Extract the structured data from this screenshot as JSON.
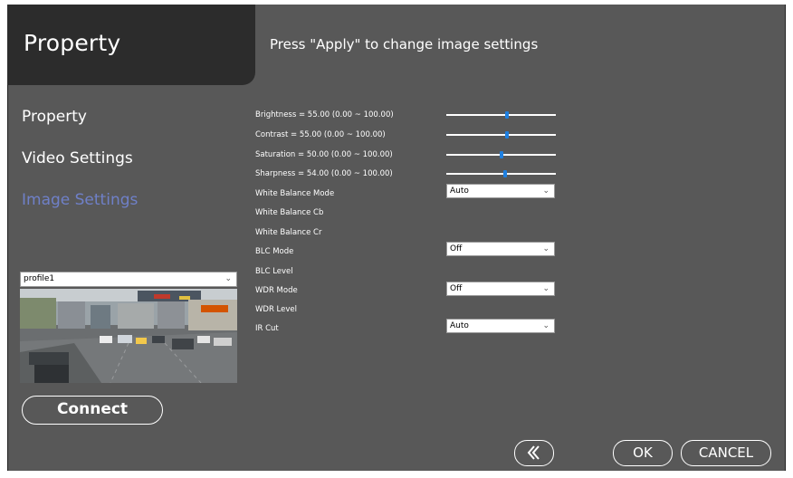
{
  "header": {
    "title": "Property",
    "message": "Press \"Apply\" to change image settings"
  },
  "sidebar": {
    "items": [
      {
        "label": "Property",
        "active": false
      },
      {
        "label": "Video Settings",
        "active": false
      },
      {
        "label": "Image Settings",
        "active": true
      }
    ],
    "profile_select": {
      "value": "profile1",
      "icon": "chevron-down-icon"
    },
    "connect_label": "Connect"
  },
  "settings": {
    "sliders": [
      {
        "label": "Brightness = 55.00 (0.00 ~ 100.00)",
        "value": 55.0,
        "min": 0.0,
        "max": 100.0
      },
      {
        "label": "Contrast = 55.00 (0.00 ~ 100.00)",
        "value": 55.0,
        "min": 0.0,
        "max": 100.0
      },
      {
        "label": "Saturation = 50.00 (0.00 ~ 100.00)",
        "value": 50.0,
        "min": 0.0,
        "max": 100.0
      },
      {
        "label": "Sharpness = 54.00 (0.00 ~ 100.00)",
        "value": 54.0,
        "min": 0.0,
        "max": 100.0
      }
    ],
    "white_balance_mode": {
      "label": "White Balance Mode",
      "value": "Auto"
    },
    "white_balance_cb": {
      "label": "White Balance Cb"
    },
    "white_balance_cr": {
      "label": "White Balance Cr"
    },
    "blc_mode": {
      "label": "BLC Mode",
      "value": "Off"
    },
    "blc_level": {
      "label": "BLC Level"
    },
    "wdr_mode": {
      "label": "WDR Mode",
      "value": "Off"
    },
    "wdr_level": {
      "label": "WDR Level"
    },
    "ir_cut": {
      "label": "IR Cut",
      "value": "Auto"
    }
  },
  "footer": {
    "back_icon": "double-chevron-left-icon",
    "ok_label": "OK",
    "cancel_label": "CANCEL"
  },
  "colors": {
    "panel_bg": "#585858",
    "title_bg": "#2c2c2c",
    "active_nav": "#6f80c8",
    "slider_thumb": "#1e7fe0"
  }
}
